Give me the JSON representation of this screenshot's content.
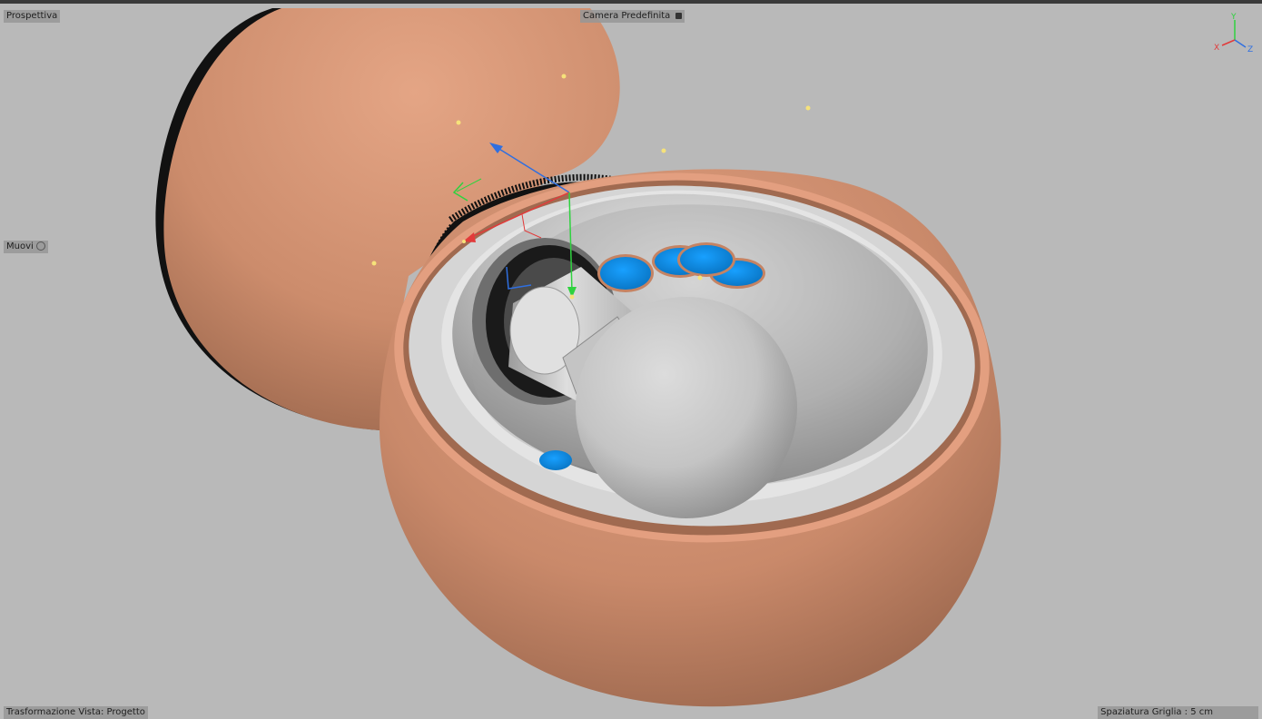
{
  "viewport": {
    "view_name": "Prospettiva",
    "camera_name": "Camera Predefinita",
    "active_tool": "Muovi",
    "view_transform": "Trasformazione Vista: Progetto",
    "grid_spacing": "Spaziatura Griglia : 5 cm"
  },
  "axis_gizmo": {
    "x_label": "X",
    "y_label": "Y",
    "z_label": "Z"
  },
  "colors": {
    "background": "#b9b9b9",
    "shell": "#d8977a",
    "inner": "#c8c8c8",
    "buttons": "#0a8ee6",
    "axis_x": "#e23a3a",
    "axis_y": "#2fd23f",
    "axis_z": "#2f6fe0",
    "light_points": "#f6e27a"
  }
}
